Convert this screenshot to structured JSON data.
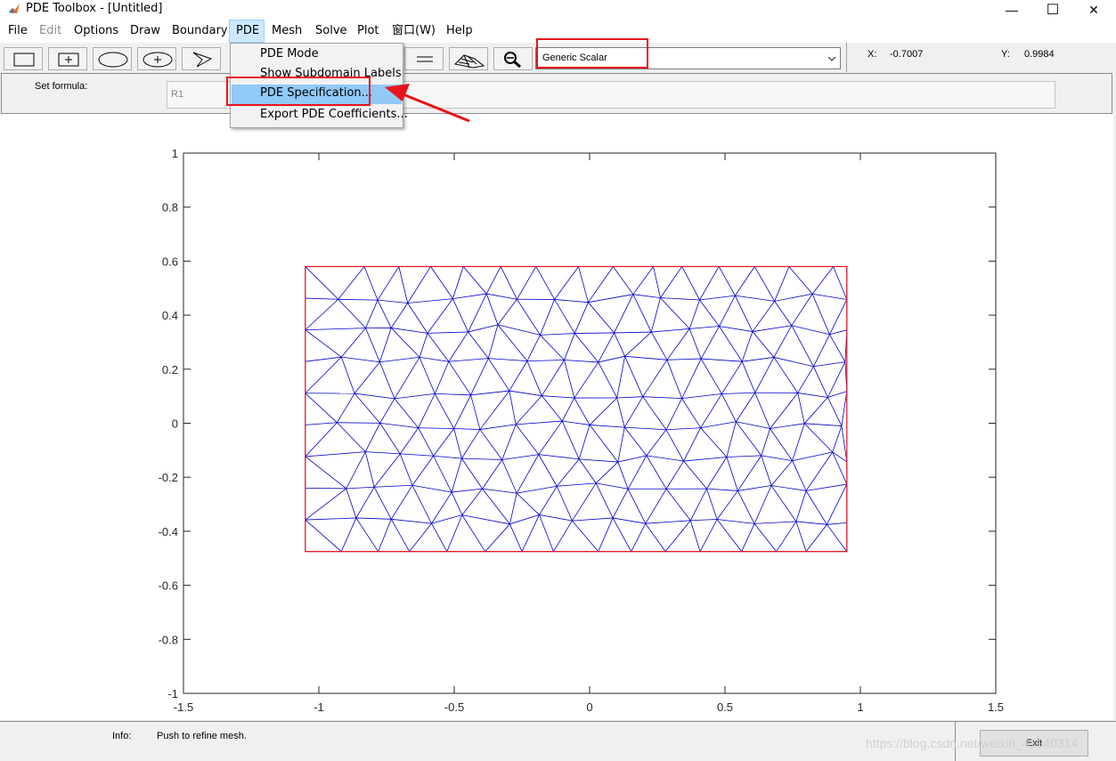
{
  "window": {
    "title": "PDE Toolbox - [Untitled]",
    "minimize": "—",
    "maximize": "☐",
    "close": "✕"
  },
  "menubar": {
    "items": [
      "File",
      "Edit",
      "Options",
      "Draw",
      "Boundary",
      "PDE",
      "Mesh",
      "Solve",
      "Plot",
      "窗口(W)",
      "Help"
    ]
  },
  "pde_menu": {
    "items": [
      "PDE Mode",
      "Show Subdomain Labels",
      "PDE Specification...",
      "Export PDE Coefficients..."
    ],
    "highlighted": "PDE Specification..."
  },
  "toolbar": {
    "mode_value": "Generic Scalar",
    "x_label": "X:",
    "x_value": "-0.7007",
    "y_label": "Y:",
    "y_value": "0.9984"
  },
  "formula": {
    "label": "Set formula:",
    "value": "R1"
  },
  "status": {
    "info_label": "Info:",
    "info_text": "Push to refine mesh.",
    "exit_label": "Exit",
    "watermark": "https://blog.csdn.net/weixin_43940314"
  },
  "colors": {
    "mesh": "#0000cc",
    "boundary": "#e8141b",
    "annotation": "#e8141b",
    "menu_highlight": "#91c9f7"
  },
  "chart_data": {
    "type": "mesh",
    "xlim": [
      -1.5,
      1.5
    ],
    "ylim": [
      -1,
      1
    ],
    "x_ticks": [
      -1.5,
      -1,
      -0.5,
      0,
      0.5,
      1,
      1.5
    ],
    "y_ticks": [
      1,
      0.8,
      0.6,
      0.4,
      0.2,
      0,
      -0.2,
      -0.4,
      -0.6,
      -0.8,
      -1
    ],
    "x_tick_labels": [
      "-1.5",
      "-1",
      "-0.5",
      "0",
      "0.5",
      "1",
      "1.5"
    ],
    "y_tick_labels": [
      "1",
      "0.8",
      "0.6",
      "0.4",
      "0.2",
      "0",
      "-0.2",
      "-0.4",
      "-0.6",
      "-0.8",
      "-1"
    ],
    "rectangle": {
      "x": [
        -1.05,
        0.95
      ],
      "y": [
        -0.475,
        0.58
      ]
    },
    "mesh_spacing": 0.13
  }
}
